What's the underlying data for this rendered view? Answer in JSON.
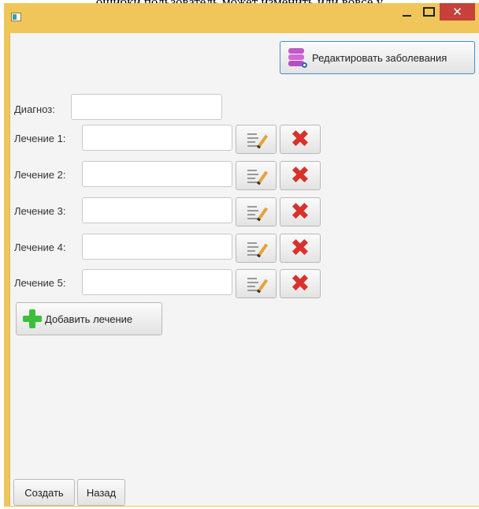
{
  "background_text": "ошибки пользователь может изменить или вовсе у",
  "window": {
    "close_glyph": "✕"
  },
  "toolbar": {
    "edit_diseases_label": "Редактировать заболевания",
    "edit_diseases_icon": "database-edit-icon"
  },
  "form": {
    "diagnosis_label": "Диагноз:",
    "diagnosis_value": "",
    "treatments": [
      {
        "label": "Лечение 1:",
        "value": ""
      },
      {
        "label": "Лечение 2:",
        "value": ""
      },
      {
        "label": "Лечение 3:",
        "value": ""
      },
      {
        "label": "Лечение 4:",
        "value": ""
      },
      {
        "label": "Лечение 5:",
        "value": ""
      }
    ],
    "edit_icon": "edit-document-icon",
    "delete_icon": "red-x-icon",
    "delete_glyph": "✖",
    "add_treatment_label": "Добавить лечение",
    "add_icon": "green-plus-icon"
  },
  "footer": {
    "create_label": "Создать",
    "back_label": "Назад"
  },
  "colors": {
    "window_frame": "#f0c65a",
    "close_button": "#c7403a",
    "client_bg": "#f4f4f4",
    "delete_red": "#d9312b",
    "add_green": "#3bbf3b",
    "focus_blue": "#3f8fd0"
  }
}
